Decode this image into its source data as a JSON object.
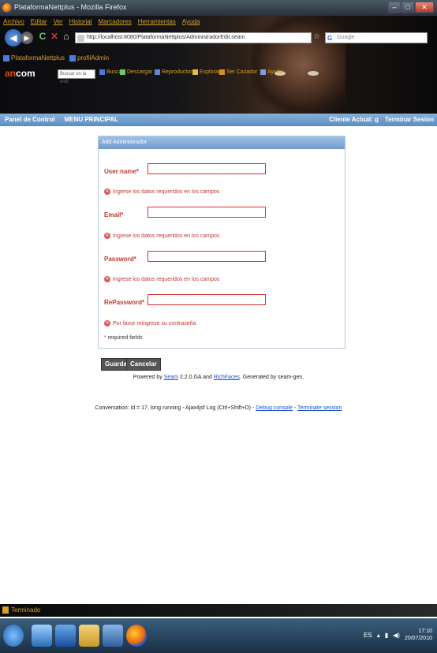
{
  "window": {
    "title": "PlataformaNettplus - Mozilla Firefox",
    "min": "–",
    "max": "□",
    "close": "✕"
  },
  "menu": [
    "Archivo",
    "Editar",
    "Ver",
    "Historial",
    "Marcadores",
    "Herramientas",
    "Ayuda"
  ],
  "nav": {
    "url": "http://localhost:8080/PlataformaNettplus/AdministradorEdit.seam",
    "search_placeholder": "Google"
  },
  "bookmarks": [
    {
      "label": "PlataformaNettplus"
    },
    {
      "label": "profilAdmin"
    }
  ],
  "toolbar2": {
    "logo_an": "an",
    "logo_com": "com",
    "search_placeholder": "Buscar en la web",
    "items": [
      "Buscar",
      "Descargar",
      "Reproductor",
      "Explorar",
      "Ser Cazador",
      "Ayuda"
    ]
  },
  "header": {
    "panel_control": "Panel de Control",
    "menu_principal": "MENU PRINCIPAL",
    "cliente_actual": "Cliente Actual: g",
    "terminar": "Terminar Sesion"
  },
  "form": {
    "title": "Add Administrador",
    "fields": [
      {
        "label": "User name",
        "value": "",
        "error": "Ingrese los datos requeridos en los campos"
      },
      {
        "label": "Email",
        "value": "",
        "error": "Ingrese los datos requeridos en los campos"
      },
      {
        "label": "Password",
        "value": "",
        "error": "Ingrese los datos requeridos en los campos"
      },
      {
        "label": "RePassword",
        "value": "",
        "error": "Por favor reingrese su contraseña"
      }
    ],
    "required_asterisk": "*",
    "required_note": " required fields",
    "save": "Guardar",
    "cancel": "Cancelar"
  },
  "footer": {
    "powered_prefix": "Powered by ",
    "seam": "Seam",
    "powered_mid": " 2.2.0.GA and ",
    "richfaces": "RichFaces",
    "powered_suffix": ". Generated by seam-gen.",
    "conversation": "Conversation: id = 17, long running - Ajax4jsf Log (Ctrl+Shift+D) - ",
    "debug": "Debug console",
    "sep": " - ",
    "terminate": "Terminate session"
  },
  "status": {
    "text": "Terminado"
  },
  "tray": {
    "lang": "ES",
    "time": "17:10",
    "date": "20/07/2010"
  },
  "colors": {
    "accent_blue": "#5c8cc0",
    "error_red": "#c0392b",
    "link_blue": "#1a4fd6",
    "button_dark": "#555555"
  }
}
